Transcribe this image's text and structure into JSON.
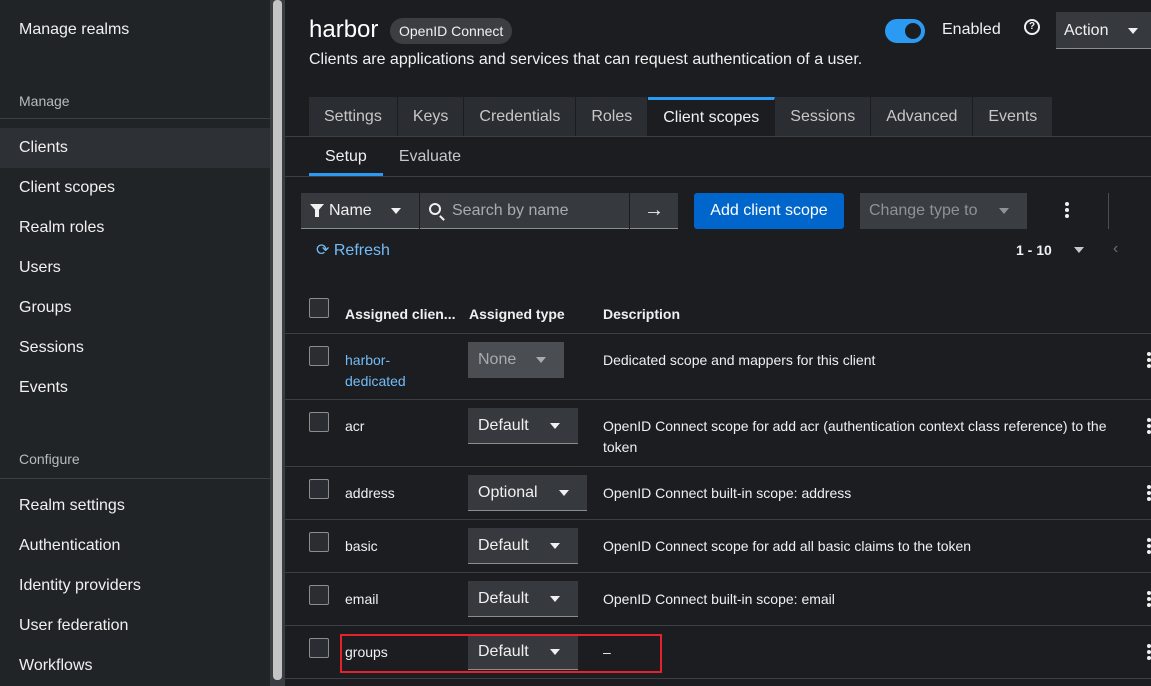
{
  "sidebar": {
    "manage_realms": "Manage realms",
    "manage_heading": "Manage",
    "manage_items": [
      "Clients",
      "Client scopes",
      "Realm roles",
      "Users",
      "Groups",
      "Sessions",
      "Events"
    ],
    "configure_heading": "Configure",
    "configure_items": [
      "Realm settings",
      "Authentication",
      "Identity providers",
      "User federation",
      "Workflows"
    ]
  },
  "header": {
    "title": "harbor",
    "protocol_badge": "OpenID Connect",
    "subtitle": "Clients are applications and services that can request authentication of a user.",
    "enabled_label": "Enabled",
    "enabled": true,
    "action_label": "Action"
  },
  "tabs": [
    "Settings",
    "Keys",
    "Credentials",
    "Roles",
    "Client scopes",
    "Sessions",
    "Advanced",
    "Events"
  ],
  "subtabs": [
    "Setup",
    "Evaluate"
  ],
  "toolbar": {
    "filter_label": "Name",
    "search_placeholder": "Search by name",
    "search_go": "→",
    "add_button": "Add client scope",
    "change_type": "Change type to",
    "refresh": "Refresh",
    "pagination": "1 - 10"
  },
  "table": {
    "columns": [
      "Assigned clien...",
      "Assigned type",
      "Description"
    ],
    "rows": [
      {
        "name_line1": "harbor-",
        "name_line2": "dedicated",
        "type": "None",
        "desc_line1": "Dedicated scope and mappers for this client",
        "desc_line2": ""
      },
      {
        "name_line1": "acr",
        "name_line2": "",
        "type": "Default",
        "desc_line1": "OpenID Connect scope for add acr (authentication context class reference) to the",
        "desc_line2": "token"
      },
      {
        "name_line1": "address",
        "name_line2": "",
        "type": "Optional",
        "desc_line1": "OpenID Connect built-in scope: address",
        "desc_line2": ""
      },
      {
        "name_line1": "basic",
        "name_line2": "",
        "type": "Default",
        "desc_line1": "OpenID Connect scope for add all basic claims to the token",
        "desc_line2": ""
      },
      {
        "name_line1": "email",
        "name_line2": "",
        "type": "Default",
        "desc_line1": "OpenID Connect built-in scope: email",
        "desc_line2": ""
      },
      {
        "name_line1": "groups",
        "name_line2": "",
        "type": "Default",
        "desc_line1": "–",
        "desc_line2": ""
      }
    ]
  },
  "colors": {
    "accent": "#2b9af3",
    "primary_button": "#0066cc",
    "link": "#73bcf7",
    "highlight": "#e5222c"
  }
}
